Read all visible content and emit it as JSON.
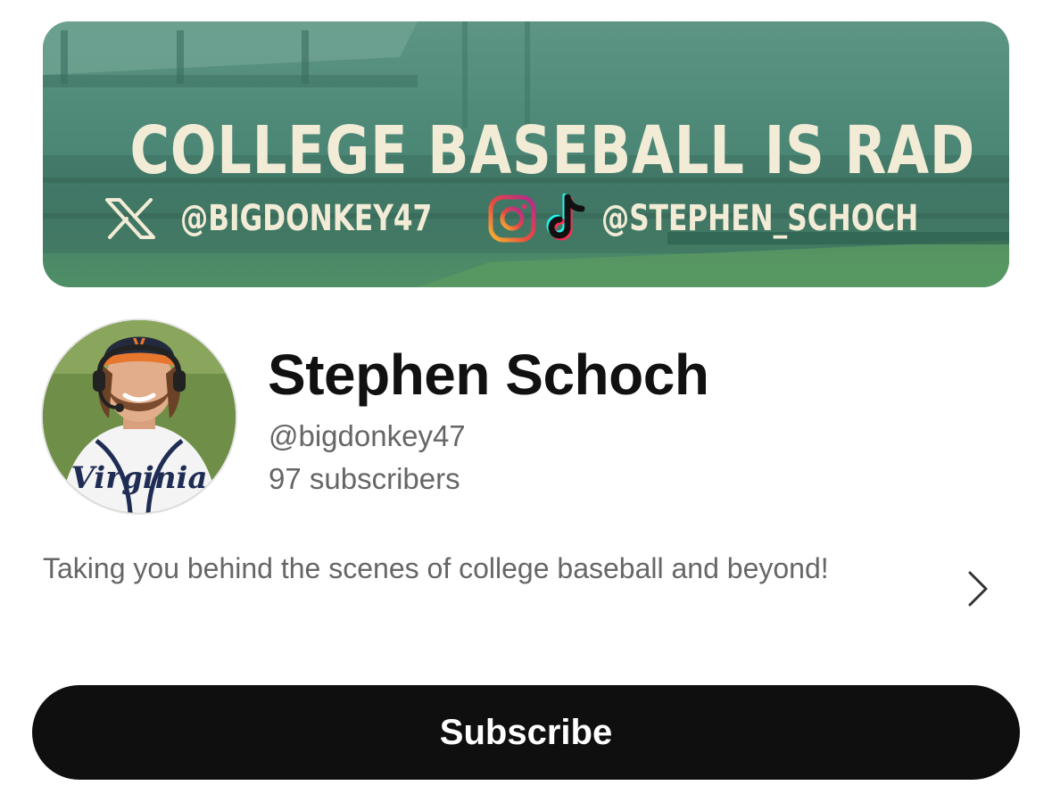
{
  "banner": {
    "title": "COLLEGE BASEBALL IS RAD",
    "x_handle": "@BIGDONKEY47",
    "ig_tiktok_handle": "@STEPHEN_SCHOCH",
    "icons": [
      "x-icon",
      "instagram-icon",
      "tiktok-icon"
    ],
    "colors": {
      "background": "#4f8a79",
      "text": "#f2ecd6"
    }
  },
  "profile": {
    "name": "Stephen Schoch",
    "handle": "@bigdonkey47",
    "subscribers": "97 subscribers",
    "avatar_jersey_text": "Virginia",
    "description": "Taking you behind the scenes of college baseball and beyond!"
  },
  "actions": {
    "subscribe_label": "Subscribe",
    "more_icon": "chevron-right-icon"
  },
  "colors": {
    "primary_button": "#0f0f0f",
    "name_text": "#111111",
    "secondary_text": "#666666"
  }
}
